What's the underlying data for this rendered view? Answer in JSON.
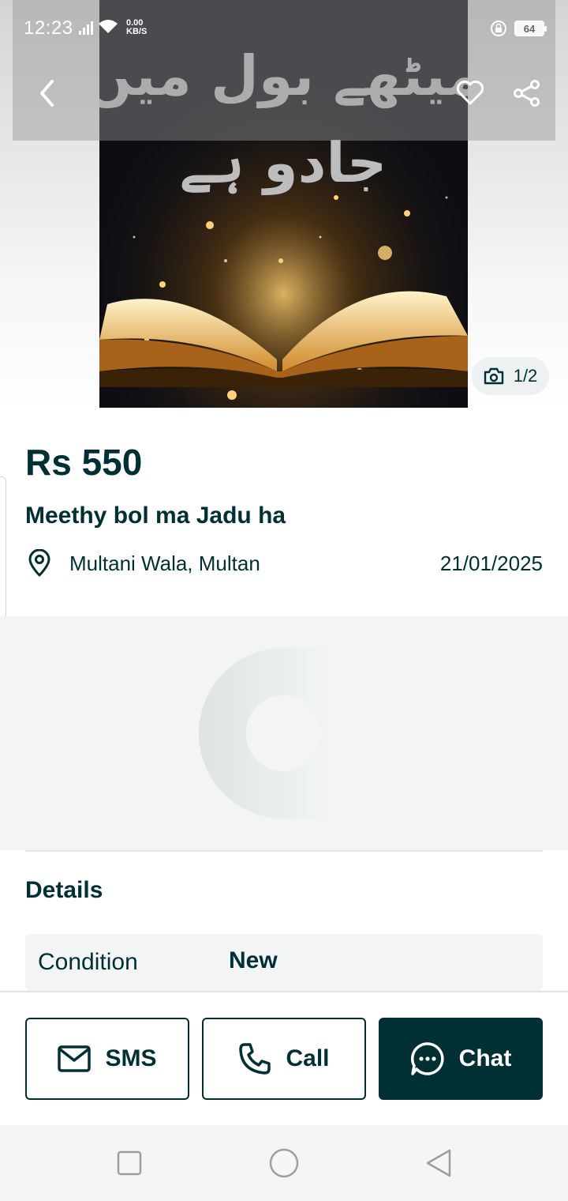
{
  "status_bar": {
    "time": "12:23",
    "net_speed_value": "0.00",
    "net_speed_unit": "KB/S",
    "battery": "64"
  },
  "listing": {
    "image_title": "میٹھے بول میں جادو ہے",
    "photo_counter": "1/2",
    "price": "Rs 550",
    "title": "Meethy bol ma Jadu ha",
    "location": "Multani Wala, Multan",
    "date": "21/01/2025"
  },
  "details": {
    "heading": "Details",
    "rows": [
      {
        "label": "Condition",
        "value": "New"
      }
    ]
  },
  "actions": {
    "sms": "SMS",
    "call": "Call",
    "chat": "Chat"
  },
  "colors": {
    "primary": "#002f34",
    "surface": "#f2f4f5"
  }
}
